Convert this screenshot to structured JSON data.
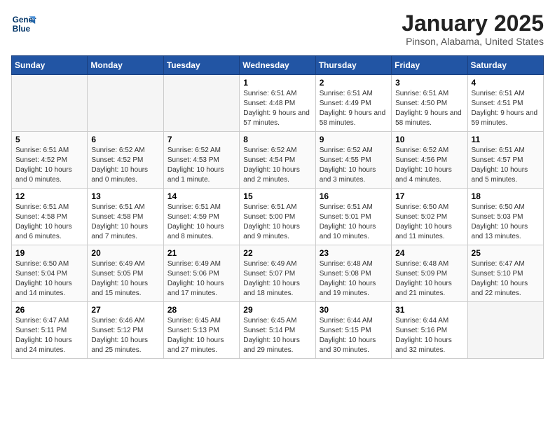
{
  "header": {
    "logo_line1": "General",
    "logo_line2": "Blue",
    "title": "January 2025",
    "subtitle": "Pinson, Alabama, United States"
  },
  "days_of_week": [
    "Sunday",
    "Monday",
    "Tuesday",
    "Wednesday",
    "Thursday",
    "Friday",
    "Saturday"
  ],
  "weeks": [
    [
      {
        "day": "",
        "empty": true
      },
      {
        "day": "",
        "empty": true
      },
      {
        "day": "",
        "empty": true
      },
      {
        "day": "1",
        "sunrise": "6:51 AM",
        "sunset": "4:48 PM",
        "daylight": "9 hours and 57 minutes."
      },
      {
        "day": "2",
        "sunrise": "6:51 AM",
        "sunset": "4:49 PM",
        "daylight": "9 hours and 58 minutes."
      },
      {
        "day": "3",
        "sunrise": "6:51 AM",
        "sunset": "4:50 PM",
        "daylight": "9 hours and 58 minutes."
      },
      {
        "day": "4",
        "sunrise": "6:51 AM",
        "sunset": "4:51 PM",
        "daylight": "9 hours and 59 minutes."
      }
    ],
    [
      {
        "day": "5",
        "sunrise": "6:51 AM",
        "sunset": "4:52 PM",
        "daylight": "10 hours and 0 minutes."
      },
      {
        "day": "6",
        "sunrise": "6:52 AM",
        "sunset": "4:52 PM",
        "daylight": "10 hours and 0 minutes."
      },
      {
        "day": "7",
        "sunrise": "6:52 AM",
        "sunset": "4:53 PM",
        "daylight": "10 hours and 1 minute."
      },
      {
        "day": "8",
        "sunrise": "6:52 AM",
        "sunset": "4:54 PM",
        "daylight": "10 hours and 2 minutes."
      },
      {
        "day": "9",
        "sunrise": "6:52 AM",
        "sunset": "4:55 PM",
        "daylight": "10 hours and 3 minutes."
      },
      {
        "day": "10",
        "sunrise": "6:52 AM",
        "sunset": "4:56 PM",
        "daylight": "10 hours and 4 minutes."
      },
      {
        "day": "11",
        "sunrise": "6:51 AM",
        "sunset": "4:57 PM",
        "daylight": "10 hours and 5 minutes."
      }
    ],
    [
      {
        "day": "12",
        "sunrise": "6:51 AM",
        "sunset": "4:58 PM",
        "daylight": "10 hours and 6 minutes."
      },
      {
        "day": "13",
        "sunrise": "6:51 AM",
        "sunset": "4:58 PM",
        "daylight": "10 hours and 7 minutes."
      },
      {
        "day": "14",
        "sunrise": "6:51 AM",
        "sunset": "4:59 PM",
        "daylight": "10 hours and 8 minutes."
      },
      {
        "day": "15",
        "sunrise": "6:51 AM",
        "sunset": "5:00 PM",
        "daylight": "10 hours and 9 minutes."
      },
      {
        "day": "16",
        "sunrise": "6:51 AM",
        "sunset": "5:01 PM",
        "daylight": "10 hours and 10 minutes."
      },
      {
        "day": "17",
        "sunrise": "6:50 AM",
        "sunset": "5:02 PM",
        "daylight": "10 hours and 11 minutes."
      },
      {
        "day": "18",
        "sunrise": "6:50 AM",
        "sunset": "5:03 PM",
        "daylight": "10 hours and 13 minutes."
      }
    ],
    [
      {
        "day": "19",
        "sunrise": "6:50 AM",
        "sunset": "5:04 PM",
        "daylight": "10 hours and 14 minutes."
      },
      {
        "day": "20",
        "sunrise": "6:49 AM",
        "sunset": "5:05 PM",
        "daylight": "10 hours and 15 minutes."
      },
      {
        "day": "21",
        "sunrise": "6:49 AM",
        "sunset": "5:06 PM",
        "daylight": "10 hours and 17 minutes."
      },
      {
        "day": "22",
        "sunrise": "6:49 AM",
        "sunset": "5:07 PM",
        "daylight": "10 hours and 18 minutes."
      },
      {
        "day": "23",
        "sunrise": "6:48 AM",
        "sunset": "5:08 PM",
        "daylight": "10 hours and 19 minutes."
      },
      {
        "day": "24",
        "sunrise": "6:48 AM",
        "sunset": "5:09 PM",
        "daylight": "10 hours and 21 minutes."
      },
      {
        "day": "25",
        "sunrise": "6:47 AM",
        "sunset": "5:10 PM",
        "daylight": "10 hours and 22 minutes."
      }
    ],
    [
      {
        "day": "26",
        "sunrise": "6:47 AM",
        "sunset": "5:11 PM",
        "daylight": "10 hours and 24 minutes."
      },
      {
        "day": "27",
        "sunrise": "6:46 AM",
        "sunset": "5:12 PM",
        "daylight": "10 hours and 25 minutes."
      },
      {
        "day": "28",
        "sunrise": "6:45 AM",
        "sunset": "5:13 PM",
        "daylight": "10 hours and 27 minutes."
      },
      {
        "day": "29",
        "sunrise": "6:45 AM",
        "sunset": "5:14 PM",
        "daylight": "10 hours and 29 minutes."
      },
      {
        "day": "30",
        "sunrise": "6:44 AM",
        "sunset": "5:15 PM",
        "daylight": "10 hours and 30 minutes."
      },
      {
        "day": "31",
        "sunrise": "6:44 AM",
        "sunset": "5:16 PM",
        "daylight": "10 hours and 32 minutes."
      },
      {
        "day": "",
        "empty": true
      }
    ]
  ]
}
